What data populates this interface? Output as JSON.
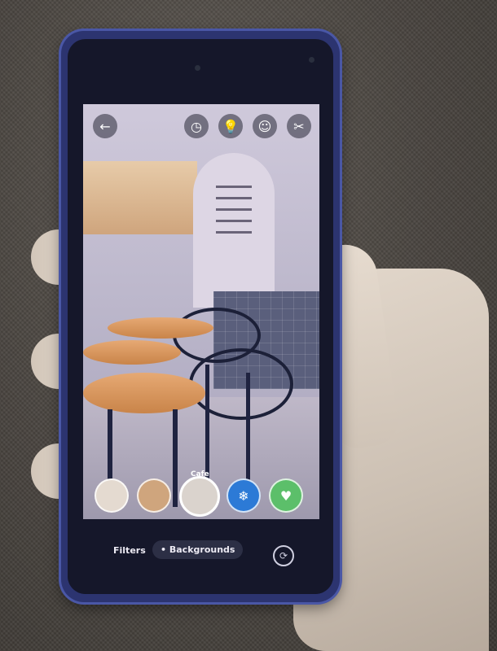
{
  "camera": {
    "icons": {
      "back": "arrow-left-icon",
      "timer": "timer-icon",
      "bulb": "bulb-icon",
      "face": "face-mask-icon",
      "tools": "tools-icon",
      "switch": "camera-switch-icon"
    },
    "selected_filter_label": "Cafe",
    "tabs": {
      "filters_label": "Filters",
      "backgrounds_label": "Backgrounds",
      "backgrounds_marker": "•"
    }
  },
  "colors": {
    "phone_frame": "#2c3470",
    "active_tab_bg": "#2c2f45",
    "background_fabric": "#48433e"
  }
}
